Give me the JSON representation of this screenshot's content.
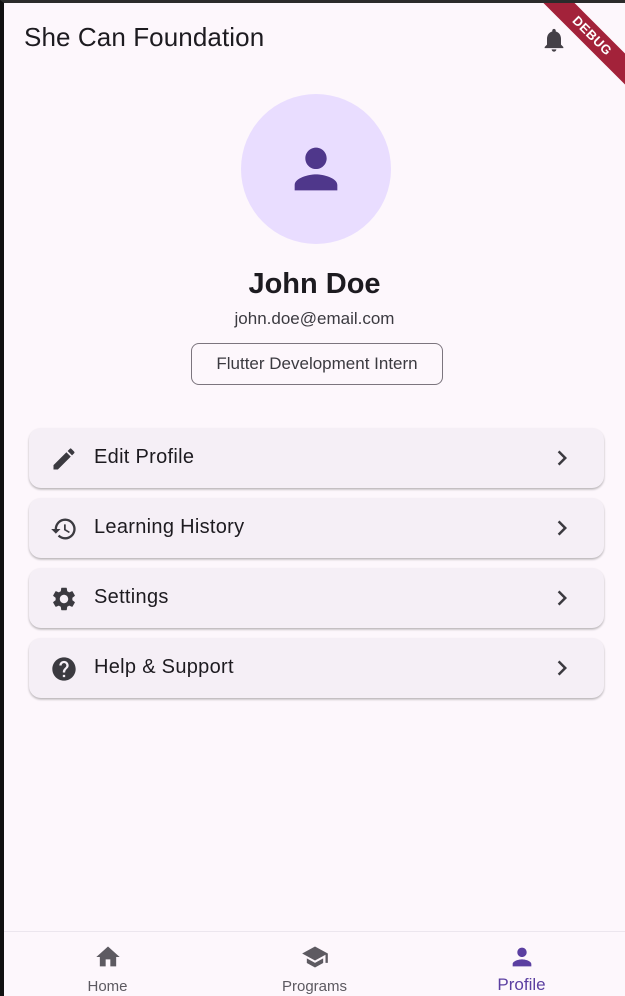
{
  "appbar": {
    "title": "She Can Foundation",
    "notification_icon": "bell-icon",
    "debug_banner": "DEBUG"
  },
  "profile": {
    "avatar_icon": "person-icon",
    "name": "John Doe",
    "email": "john.doe@email.com",
    "role": "Flutter Development Intern"
  },
  "menu": {
    "items": [
      {
        "label": "Edit Profile",
        "icon": "pencil-icon"
      },
      {
        "label": "Learning History",
        "icon": "history-icon"
      },
      {
        "label": "Settings",
        "icon": "gear-icon"
      },
      {
        "label": "Help & Support",
        "icon": "help-circle-icon"
      }
    ],
    "trailing_icon": "chevron-right-icon"
  },
  "bottom_nav": {
    "items": [
      {
        "label": "Home",
        "icon": "home-icon",
        "active": false
      },
      {
        "label": "Programs",
        "icon": "graduation-cap-icon",
        "active": false
      },
      {
        "label": "Profile",
        "icon": "person-icon",
        "active": true
      }
    ]
  },
  "colors": {
    "background": "#fdf7fc",
    "accent": "#5b3fa1",
    "avatar_bg": "#e9ddff",
    "card_bg": "#f5eff6",
    "debug_ribbon": "#a3223a"
  }
}
